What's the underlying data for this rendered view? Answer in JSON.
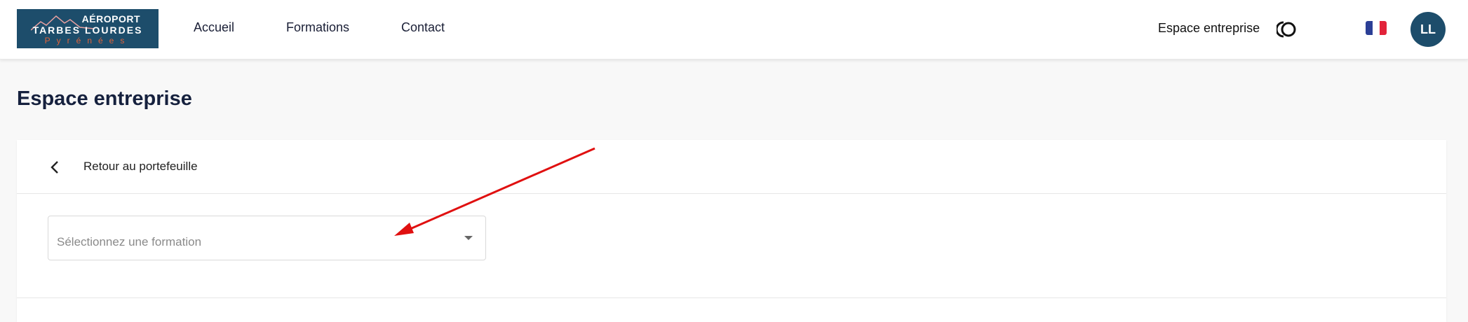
{
  "logo": {
    "line1": "AÉROPORT",
    "line2": "TARBES LOURDES",
    "line3": "Pyrénées",
    "icon": "mountains-logo"
  },
  "nav": {
    "items": [
      {
        "label": "Accueil"
      },
      {
        "label": "Formations"
      },
      {
        "label": "Contact"
      }
    ],
    "espace_label": "Espace entreprise",
    "theme_icon": "theme-toggle-icon",
    "flag_icon": "french-flag-icon",
    "avatar_initials": "LL"
  },
  "page": {
    "title": "Espace entreprise"
  },
  "card": {
    "back_label": "Retour au portefeuille",
    "back_icon": "chevron-left-icon",
    "select_placeholder": "Sélectionnez une formation",
    "select_icon": "caret-down-icon"
  },
  "colors": {
    "brand": "#1d4d6b",
    "accent": "#e0623a",
    "annotation": "#e01010"
  }
}
